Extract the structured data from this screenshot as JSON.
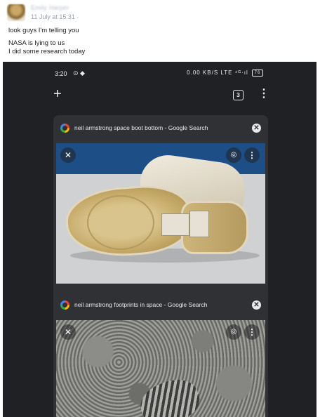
{
  "post": {
    "author": "Emily Harper",
    "timestamp": "11 July at 15:31 ·",
    "lines": [
      "look guys I'm telling you",
      "NASA is lying to us",
      "I did some research today"
    ]
  },
  "phone": {
    "status": {
      "time": "3:20",
      "left_icons": "⊙ ◆",
      "right_info": "0.00 KB/S LTE ",
      "signal": "⁴ᴳ·ıl",
      "battery": "76"
    },
    "toolbar": {
      "new_tab_icon": "plus-icon",
      "tab_count": "3",
      "menu_icon": "more-vert-icon"
    },
    "tabs": [
      {
        "title": "neil armstrong space boot bottom - Google Search",
        "image": "space boot sole photo"
      },
      {
        "title": "neil armstrong footprints in space - Google Search",
        "image": "moon footprint photo"
      }
    ]
  },
  "colors": {
    "phone_bg": "#202124",
    "card_bg": "#303134",
    "text_light": "#e8eaed"
  }
}
